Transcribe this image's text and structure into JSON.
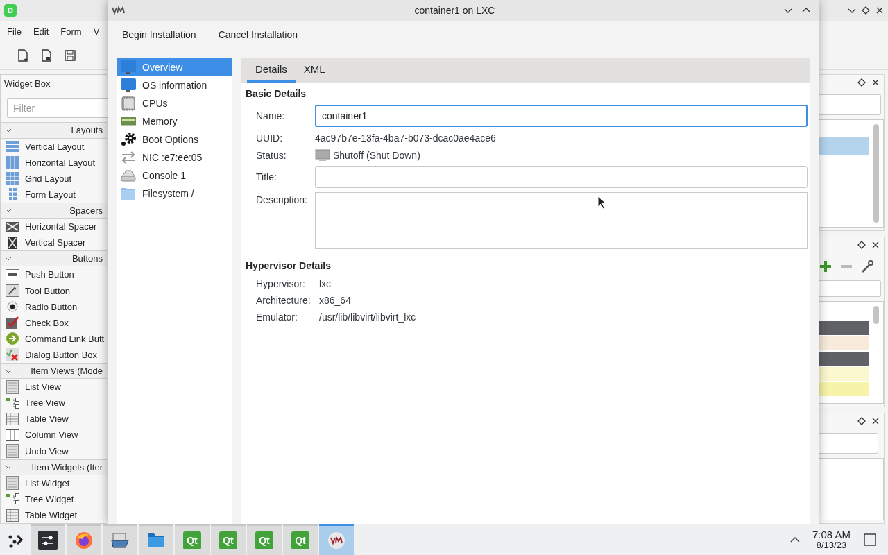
{
  "designer": {
    "logo": "D",
    "menu": [
      "File",
      "Edit",
      "Form",
      "V"
    ],
    "widget_box": {
      "title": "Widget Box",
      "filter_placeholder": "Filter",
      "groups": [
        {
          "title": "Layouts",
          "expanded": true,
          "items": [
            {
              "label": "Vertical Layout",
              "kind": "vlayout"
            },
            {
              "label": "Horizontal Layout",
              "kind": "hlayout"
            },
            {
              "label": "Grid Layout",
              "kind": "grid"
            },
            {
              "label": "Form Layout",
              "kind": "form"
            }
          ]
        },
        {
          "title": "Spacers",
          "expanded": true,
          "items": [
            {
              "label": "Horizontal Spacer",
              "kind": "hspacer"
            },
            {
              "label": "Vertical Spacer",
              "kind": "vspacer"
            }
          ]
        },
        {
          "title": "Buttons",
          "expanded": true,
          "items": [
            {
              "label": "Push Button",
              "kind": "push"
            },
            {
              "label": "Tool Button",
              "kind": "tool"
            },
            {
              "label": "Radio Button",
              "kind": "radio"
            },
            {
              "label": "Check Box",
              "kind": "check"
            },
            {
              "label": "Command Link Butt",
              "kind": "cmdlink"
            },
            {
              "label": "Dialog Button Box",
              "kind": "dialogbtn"
            }
          ]
        },
        {
          "title": "Item Views (Mode",
          "expanded": true,
          "items": [
            {
              "label": "List View",
              "kind": "list"
            },
            {
              "label": "Tree View",
              "kind": "tree"
            },
            {
              "label": "Table View",
              "kind": "table"
            },
            {
              "label": "Column View",
              "kind": "column"
            },
            {
              "label": "Undo View",
              "kind": "list"
            }
          ]
        },
        {
          "title": "Item Widgets (Iter",
          "expanded": true,
          "items": [
            {
              "label": "List Widget",
              "kind": "list"
            },
            {
              "label": "Tree Widget",
              "kind": "tree"
            },
            {
              "label": "Table Widget",
              "kind": "table"
            }
          ]
        }
      ]
    },
    "swatches": [
      {
        "color": "#5f6166"
      },
      {
        "color": "#f8ebdc"
      },
      {
        "color": "#5f6166"
      },
      {
        "color": "#fbf8cf"
      },
      {
        "color": "#f7f3a8"
      }
    ]
  },
  "dialog": {
    "title": "container1 on LXC",
    "actions": [
      "Begin Installation",
      "Cancel Installation"
    ],
    "nav": [
      {
        "label": "Overview",
        "kind": "monitor",
        "selected": true
      },
      {
        "label": "OS information",
        "kind": "monitor",
        "selected": false
      },
      {
        "label": "CPUs",
        "kind": "cpu",
        "selected": false
      },
      {
        "label": "Memory",
        "kind": "memory",
        "selected": false
      },
      {
        "label": "Boot Options",
        "kind": "gears",
        "selected": false
      },
      {
        "label": "NIC :e7:ee:05",
        "kind": "nic",
        "selected": false
      },
      {
        "label": "Console 1",
        "kind": "console",
        "selected": false
      },
      {
        "label": "Filesystem /",
        "kind": "folder",
        "selected": false
      }
    ],
    "tabs": [
      {
        "label": "Details",
        "selected": true
      },
      {
        "label": "XML",
        "selected": false
      }
    ],
    "basic": {
      "heading": "Basic Details",
      "fields": [
        {
          "label": "Name:",
          "kind": "input",
          "value": "container1",
          "focused": true
        },
        {
          "label": "UUID:",
          "kind": "text",
          "value": "4ac97b7e-13fa-4ba7-b073-dcac0ae4ace6"
        },
        {
          "label": "Status:",
          "kind": "status",
          "value": "Shutoff (Shut Down)"
        },
        {
          "label": "Title:",
          "kind": "input",
          "focused": false
        },
        {
          "label": "Description:",
          "kind": "textarea"
        }
      ]
    },
    "hypervisor": {
      "heading": "Hypervisor Details",
      "fields": [
        {
          "label": "Hypervisor:",
          "value": "lxc"
        },
        {
          "label": "Architecture:",
          "value": "x86_64"
        },
        {
          "label": "Emulator:",
          "value": "/usr/lib/libvirt/libvirt_lxc"
        }
      ]
    }
  },
  "taskbar": {
    "apps": [
      {
        "kind": "settings",
        "selected": false
      },
      {
        "kind": "firefox",
        "selected": false
      },
      {
        "kind": "scanner",
        "selected": false
      },
      {
        "kind": "files",
        "selected": false
      },
      {
        "kind": "qt",
        "label": "Qt",
        "selected": false
      },
      {
        "kind": "qt",
        "label": "Qt",
        "selected": false
      },
      {
        "kind": "qt",
        "label": "Qt",
        "selected": false
      },
      {
        "kind": "qt",
        "label": "Qt",
        "selected": false
      },
      {
        "kind": "vm",
        "selected": true
      }
    ],
    "time": "7:08 AM",
    "date": "8/13/23"
  }
}
